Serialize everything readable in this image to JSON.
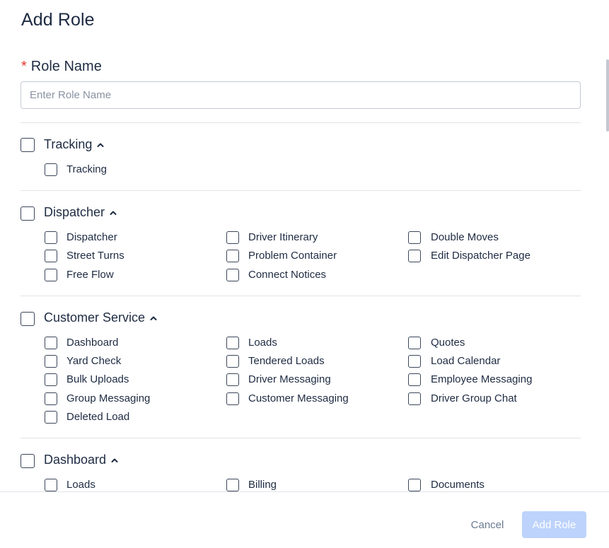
{
  "modal": {
    "title": "Add Role"
  },
  "role_name": {
    "required_mark": "*",
    "label": "Role Name",
    "placeholder": "Enter Role Name",
    "value": ""
  },
  "groups": [
    {
      "title": "Tracking",
      "checked": false,
      "expanded": true,
      "items": [
        {
          "label": "Tracking",
          "checked": false
        }
      ]
    },
    {
      "title": "Dispatcher",
      "checked": false,
      "expanded": true,
      "items": [
        {
          "label": "Dispatcher",
          "checked": false
        },
        {
          "label": "Driver Itinerary",
          "checked": false
        },
        {
          "label": "Double Moves",
          "checked": false
        },
        {
          "label": "Street Turns",
          "checked": false
        },
        {
          "label": "Problem Container",
          "checked": false
        },
        {
          "label": "Edit Dispatcher Page",
          "checked": false
        },
        {
          "label": "Free Flow",
          "checked": false
        },
        {
          "label": "Connect Notices",
          "checked": false
        }
      ]
    },
    {
      "title": "Customer Service",
      "checked": false,
      "expanded": true,
      "items": [
        {
          "label": "Dashboard",
          "checked": false
        },
        {
          "label": "Loads",
          "checked": false
        },
        {
          "label": "Quotes",
          "checked": false
        },
        {
          "label": "Yard Check",
          "checked": false
        },
        {
          "label": "Tendered Loads",
          "checked": false
        },
        {
          "label": "Load Calendar",
          "checked": false
        },
        {
          "label": "Bulk Uploads",
          "checked": false
        },
        {
          "label": "Driver Messaging",
          "checked": false
        },
        {
          "label": "Employee Messaging",
          "checked": false
        },
        {
          "label": "Group Messaging",
          "checked": false
        },
        {
          "label": "Customer Messaging",
          "checked": false
        },
        {
          "label": "Driver Group Chat",
          "checked": false
        },
        {
          "label": "Deleted Load",
          "checked": false
        }
      ]
    },
    {
      "title": "Dashboard",
      "checked": false,
      "expanded": true,
      "items": [
        {
          "label": "Loads",
          "checked": false
        },
        {
          "label": "Billing",
          "checked": false
        },
        {
          "label": "Documents",
          "checked": false
        }
      ]
    }
  ],
  "footer": {
    "cancel_label": "Cancel",
    "submit_label": "Add Role"
  },
  "colors": {
    "required": "#e0382f",
    "primary_disabled": "#bdd3fb",
    "text": "#1e2b42",
    "muted": "#6b7a90"
  },
  "icons": {
    "expand": "chevron-up-icon"
  }
}
